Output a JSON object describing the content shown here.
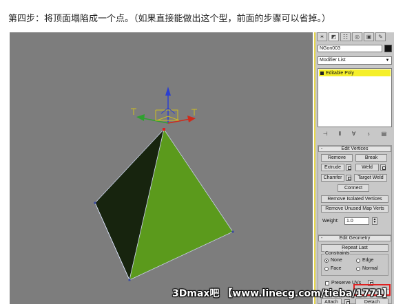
{
  "caption": "第四步：将顶面塌陷成一个点。（如果直接能做出这个型，前面的步骤可以省掉。）",
  "viewport": {
    "background": "#7d7d7d",
    "object_dark_color": "#1a2a10",
    "object_green_color": "#5b9a1c"
  },
  "command_panel": {
    "tabs": [
      "create-icon",
      "modify-icon",
      "hierarchy-icon",
      "motion-icon",
      "display-icon",
      "utilities-icon"
    ],
    "tab_glyphs": [
      "✶",
      "◩",
      "☷",
      "◎",
      "▣",
      "✎"
    ],
    "object_name": "NGon003",
    "modifier_list_label": "Modifier List",
    "stack_item": "Editable Poly",
    "edit_vertices": {
      "title": "Edit Vertices",
      "remove": "Remove",
      "break": "Break",
      "extrude": "Extrude",
      "weld": "Weld",
      "chamfer": "Chamfer",
      "target_weld": "Target Weld",
      "connect": "Connect",
      "remove_isolated": "Remove Isolated Vertices",
      "remove_unused": "Remove Unused Map Verts",
      "weight_label": "Weight:",
      "weight_value": "1.0"
    },
    "edit_geometry": {
      "title": "Edit Geometry",
      "repeat_last": "Repeat Last",
      "constraints_label": "Constraints",
      "none": "None",
      "edge": "Edge",
      "face": "Face",
      "normal": "Normal",
      "preserve_uvs": "Preserve UVs",
      "collapse_partial": "se",
      "attach": "Attach",
      "detach": "Detach"
    }
  },
  "watermark": "3Dmax吧 【www.linecg.com/tieba/1771】",
  "highlight_color": "#e02020"
}
